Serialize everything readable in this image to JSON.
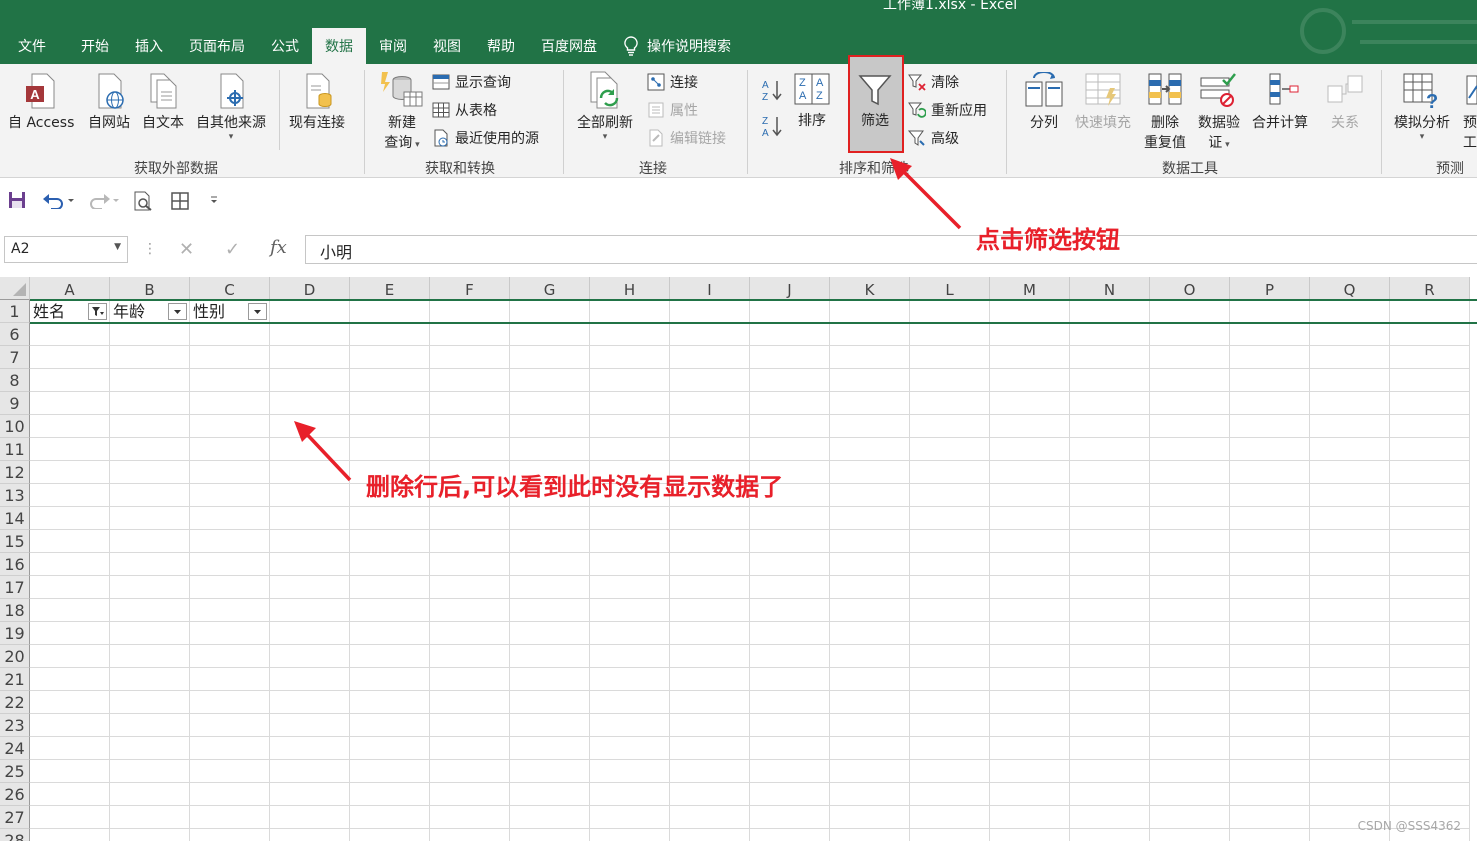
{
  "window": {
    "title": "工作簿1.xlsx  -  Excel"
  },
  "tabs": [
    {
      "label": "文件",
      "active": false
    },
    {
      "label": "开始",
      "active": false
    },
    {
      "label": "插入",
      "active": false
    },
    {
      "label": "页面布局",
      "active": false
    },
    {
      "label": "公式",
      "active": false
    },
    {
      "label": "数据",
      "active": true
    },
    {
      "label": "审阅",
      "active": false
    },
    {
      "label": "视图",
      "active": false
    },
    {
      "label": "帮助",
      "active": false
    },
    {
      "label": "百度网盘",
      "active": false
    }
  ],
  "tell_me": {
    "label": "操作说明搜索",
    "icon": "lightbulb-icon"
  },
  "ribbon": {
    "get_external": {
      "label": "获取外部数据",
      "access": "自 Access",
      "web": "自网站",
      "text": "自文本",
      "other": "自其他来源",
      "existing": "现有连接"
    },
    "get_transform": {
      "label": "获取和转换",
      "new_query_1": "新建",
      "new_query_2": "查询",
      "show_queries": "显示查询",
      "from_table": "从表格",
      "recent_sources": "最近使用的源"
    },
    "connections": {
      "label": "连接",
      "refresh_all": "全部刷新",
      "connections": "连接",
      "properties": "属性",
      "edit_links": "编辑链接"
    },
    "sort_filter": {
      "label": "排序和筛选",
      "sort": "排序",
      "filter": "筛选",
      "clear": "清除",
      "reapply": "重新应用",
      "advanced": "高级"
    },
    "data_tools": {
      "label": "数据工具",
      "text_to_columns": "分列",
      "flash_fill": "快速填充",
      "remove_dup_1": "删除",
      "remove_dup_2": "重复值",
      "validation_1": "数据验",
      "validation_2": "证",
      "consolidate": "合并计算",
      "relationships": "关系"
    },
    "forecast": {
      "label": "预测",
      "what_if": "模拟分析",
      "forecast_1": "预",
      "forecast_2": "工"
    }
  },
  "formula_bar": {
    "name_box": "A2",
    "cancel": "✕",
    "enter": "✓",
    "fx": "fx",
    "value": "小明"
  },
  "sheet": {
    "columns": [
      "A",
      "B",
      "C",
      "D",
      "E",
      "F",
      "G",
      "H",
      "I",
      "J",
      "K",
      "L",
      "M",
      "N",
      "O",
      "P",
      "Q",
      "R"
    ],
    "rows": [
      "1",
      "6",
      "7",
      "8",
      "9",
      "10",
      "11",
      "12",
      "13",
      "14",
      "15",
      "16",
      "17",
      "18",
      "19",
      "20",
      "21",
      "22",
      "23",
      "24",
      "25",
      "26",
      "27",
      "28"
    ],
    "header_cells": [
      "姓名",
      "年龄",
      "性别"
    ]
  },
  "annotations": {
    "click_filter": "点击筛选按钮",
    "after_delete": "删除行后,可以看到此时没有显示数据了"
  },
  "watermark": "CSDN @SSS4362",
  "colors": {
    "excel_green": "#217346",
    "annotation_red": "#e8202a"
  }
}
